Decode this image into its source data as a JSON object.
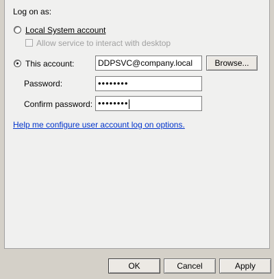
{
  "logon": {
    "section_title": "Log on as:",
    "local_system_label": "Local System account",
    "allow_desktop_label": "Allow service to interact with desktop",
    "this_account_label": "This account:",
    "account_value": "DDPSVC@company.local",
    "browse_label": "Browse...",
    "password_label": "Password:",
    "password_value": "••••••••",
    "confirm_label": "Confirm password:",
    "confirm_value": "••••••••",
    "help_link": "Help me configure user account log on options.",
    "selected_option": "this_account"
  },
  "buttons": {
    "ok_label": "OK",
    "cancel_label": "Cancel",
    "apply_label": "Apply"
  },
  "colors": {
    "link": "#0033cc",
    "disabled_text": "#a0a0a0",
    "panel_bg": "#f0f0ef",
    "dialog_bg": "#d4d0c8"
  }
}
